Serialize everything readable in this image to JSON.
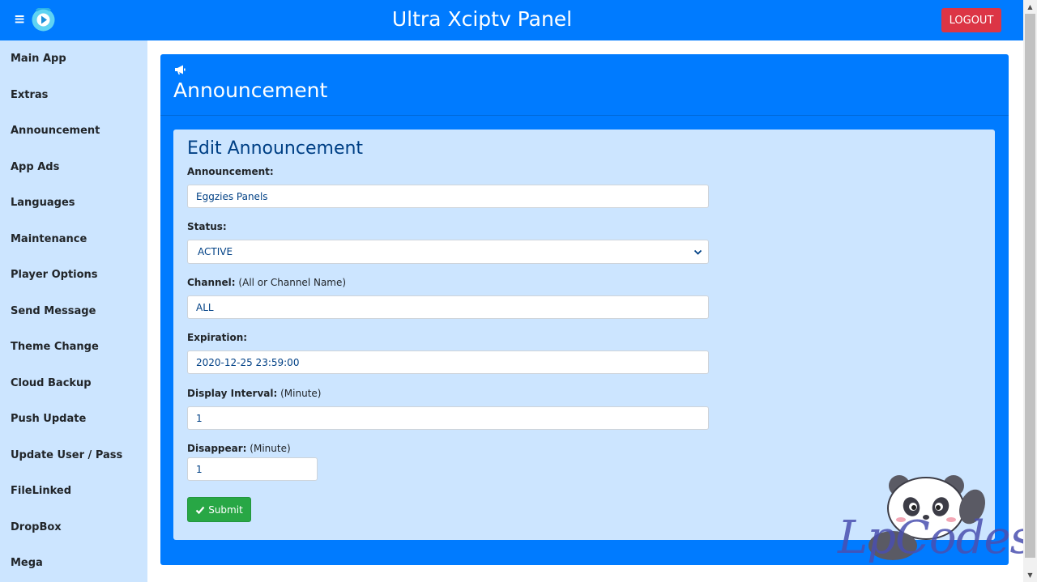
{
  "header": {
    "title": "Ultra Xciptv Panel",
    "menu_icon": "≡",
    "logout_label": "LOGOUT",
    "brand_color": "#007bff",
    "logout_color": "#dc3545"
  },
  "sidebar": {
    "items": [
      {
        "label": "Main App"
      },
      {
        "label": "Extras"
      },
      {
        "label": "Announcement"
      },
      {
        "label": "App Ads"
      },
      {
        "label": "Languages"
      },
      {
        "label": "Maintenance"
      },
      {
        "label": "Player Options"
      },
      {
        "label": "Send Message"
      },
      {
        "label": "Theme Change"
      },
      {
        "label": "Cloud Backup"
      },
      {
        "label": "Push Update"
      },
      {
        "label": "Update User / Pass"
      },
      {
        "label": "FileLinked"
      },
      {
        "label": "DropBox"
      },
      {
        "label": "Mega"
      }
    ]
  },
  "page": {
    "title": "Announcement",
    "icon": "megaphone-icon"
  },
  "form": {
    "title": "Edit Announcement",
    "announcement": {
      "label": "Announcement:",
      "value": "Eggzies Panels"
    },
    "status": {
      "label": "Status:",
      "value": "ACTIVE"
    },
    "channel": {
      "label": "Channel:",
      "hint": "(All or Channel Name)",
      "value": "ALL"
    },
    "expiration": {
      "label": "Expiration:",
      "value": "2020-12-25 23:59:00"
    },
    "display_interval": {
      "label": "Display Interval:",
      "hint": "(Minute)",
      "value": "1"
    },
    "disappear": {
      "label": "Disappear:",
      "hint": "(Minute)",
      "value": "1"
    },
    "submit_label": "Submit",
    "submit_color": "#28a745"
  },
  "watermark": {
    "text": "LpCodes"
  }
}
